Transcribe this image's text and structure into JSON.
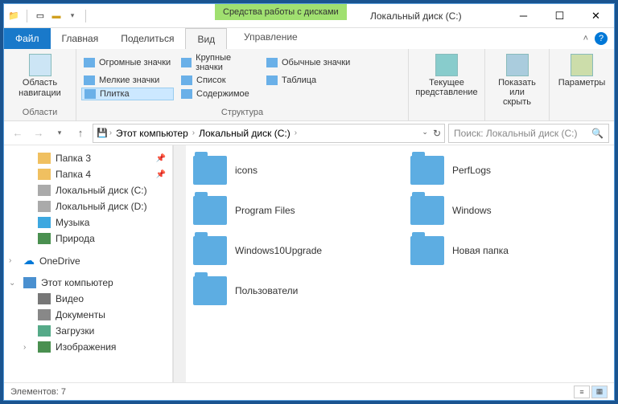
{
  "titlebar": {
    "tool_tab": "Средства работы с дисками",
    "title": "Локальный диск (C:)"
  },
  "tabs": {
    "file": "Файл",
    "home": "Главная",
    "share": "Поделиться",
    "view": "Вид",
    "manage": "Управление"
  },
  "ribbon": {
    "nav_pane": "Область навигации",
    "group_panes": "Области",
    "huge": "Огромные значки",
    "large": "Крупные значки",
    "medium": "Обычные значки",
    "small": "Мелкие значки",
    "list": "Список",
    "table": "Таблица",
    "tiles": "Плитка",
    "content": "Содержимое",
    "group_layout": "Структура",
    "current_view": "Текущее представление",
    "show_hide": "Показать или скрыть",
    "options": "Параметры"
  },
  "address": {
    "seg1": "Этот компьютер",
    "seg2": "Локальный диск (C:)"
  },
  "search": {
    "placeholder": "Поиск: Локальный диск (C:)"
  },
  "nav": {
    "folder3": "Папка 3",
    "folder4": "Папка 4",
    "diskc": "Локальный диск (C:)",
    "diskd": "Локальный диск (D:)",
    "music": "Музыка",
    "nature": "Природа",
    "onedrive": "OneDrive",
    "thispc": "Этот компьютер",
    "video": "Видео",
    "docs": "Документы",
    "downloads": "Загрузки",
    "images": "Изображения"
  },
  "folders": {
    "f0": "icons",
    "f1": "PerfLogs",
    "f2": "Program Files",
    "f3": "Windows",
    "f4": "Windows10Upgrade",
    "f5": "Новая папка",
    "f6": "Пользователи"
  },
  "status": {
    "count": "Элементов: 7"
  }
}
